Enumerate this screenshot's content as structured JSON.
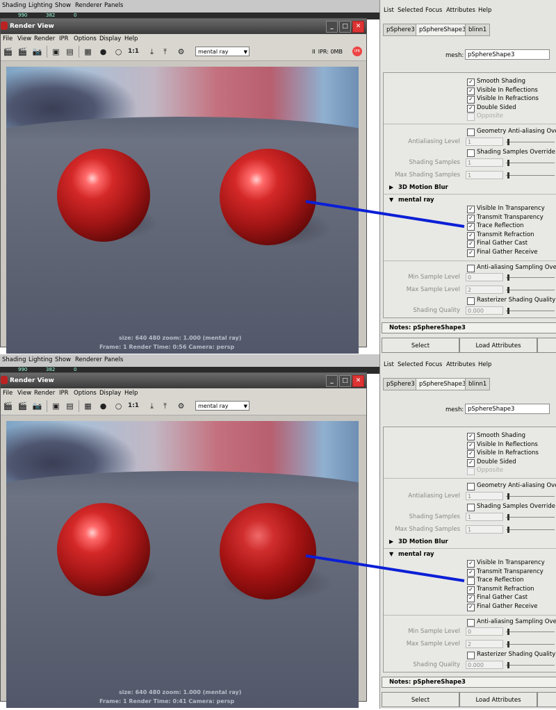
{
  "panels": [
    {
      "maya_menu": [
        "Shading",
        "Lighting",
        "Show",
        "Renderer",
        "Panels"
      ],
      "maya_strip": [
        "990",
        "382",
        "0"
      ],
      "render_view": {
        "title": "Render View",
        "menu": [
          "File",
          "View",
          "Render",
          "IPR",
          "Options",
          "Display",
          "Help"
        ],
        "ratio_label": "1:1",
        "renderer": "mental ray",
        "ipr_status": "IPR: 0MB",
        "ipr_badge": "IPR",
        "status_line1": "size:  640  480 zoom: 1.000       (mental ray)",
        "status_line2": "Frame: 1      Render Time: 0:56      Camera: persp"
      },
      "attribute_editor": {
        "menu": [
          "List",
          "Selected",
          "Focus",
          "Attributes",
          "Help"
        ],
        "tabs": [
          "pSphere3",
          "pSphereShape3",
          "blinn1"
        ],
        "mesh_label": "mesh:",
        "mesh_value": "pSphereShape3",
        "render_stats": [
          {
            "label": "Smooth Shading",
            "checked": true,
            "dim": false
          },
          {
            "label": "Visible In Reflections",
            "checked": true,
            "dim": false
          },
          {
            "label": "Visible In Refractions",
            "checked": true,
            "dim": false
          },
          {
            "label": "Double Sided",
            "checked": true,
            "dim": false
          },
          {
            "label": "Opposite",
            "checked": false,
            "dim": true
          }
        ],
        "geometry_aa_override": "Geometry Anti-aliasing Override",
        "aa_level_label": "Antialiasing Level",
        "aa_level_value": "1",
        "shading_samples_override": "Shading Samples Override",
        "shading_samples_label": "Shading Samples",
        "shading_samples_value": "1",
        "max_shading_samples_label": "Max Shading Samples",
        "max_shading_samples_value": "1",
        "section_motion_blur": "3D Motion Blur",
        "section_mental_ray": "mental ray",
        "mental_ray": [
          {
            "label": "Visible In Transparency",
            "checked": true
          },
          {
            "label": "Transmit Transparency",
            "checked": true
          },
          {
            "label": "Trace Reflection",
            "checked": true
          },
          {
            "label": "Transmit Refraction",
            "checked": true
          },
          {
            "label": "Final Gather Cast",
            "checked": true
          },
          {
            "label": "Final Gather Receive",
            "checked": true
          }
        ],
        "aa_sampling_override": "Anti-aliasing Sampling Override",
        "min_sample_label": "Min Sample Level",
        "min_sample_value": "0",
        "max_sample_label": "Max Sample Level",
        "max_sample_value": "2",
        "rasterizer_override": "Rasterizer Shading Quality Override",
        "shading_quality_label": "Shading Quality",
        "shading_quality_value": "0.000",
        "notes": "Notes:  pSphereShape3",
        "select_button": "Select",
        "load_button": "Load Attributes"
      }
    },
    {
      "maya_menu": [
        "Shading",
        "Lighting",
        "Show",
        "Renderer",
        "Panels"
      ],
      "maya_strip": [
        "990",
        "382",
        "0"
      ],
      "render_view": {
        "title": "Render View",
        "menu": [
          "File",
          "View",
          "Render",
          "IPR",
          "Options",
          "Display",
          "Help"
        ],
        "ratio_label": "1:1",
        "renderer": "mental ray",
        "ipr_status": "",
        "ipr_badge": "",
        "status_line1": "size:  640  480 zoom: 1.000       (mental ray)",
        "status_line2": "Frame: 1      Render Time: 0:41      Camera: persp"
      },
      "attribute_editor": {
        "menu": [
          "List",
          "Selected",
          "Focus",
          "Attributes",
          "Help"
        ],
        "tabs": [
          "pSphere3",
          "pSphereShape3",
          "blinn1"
        ],
        "mesh_label": "mesh:",
        "mesh_value": "pSphereShape3",
        "render_stats": [
          {
            "label": "Smooth Shading",
            "checked": true,
            "dim": false
          },
          {
            "label": "Visible In Reflections",
            "checked": true,
            "dim": false
          },
          {
            "label": "Visible In Refractions",
            "checked": true,
            "dim": false
          },
          {
            "label": "Double Sided",
            "checked": true,
            "dim": false
          },
          {
            "label": "Opposite",
            "checked": false,
            "dim": true
          }
        ],
        "geometry_aa_override": "Geometry Anti-aliasing Override",
        "aa_level_label": "Antialiasing Level",
        "aa_level_value": "1",
        "shading_samples_override": "Shading Samples Override",
        "shading_samples_label": "Shading Samples",
        "shading_samples_value": "1",
        "max_shading_samples_label": "Max Shading Samples",
        "max_shading_samples_value": "1",
        "section_motion_blur": "3D Motion Blur",
        "section_mental_ray": "mental ray",
        "mental_ray": [
          {
            "label": "Visible In Transparency",
            "checked": true
          },
          {
            "label": "Transmit Transparency",
            "checked": true
          },
          {
            "label": "Trace Reflection",
            "checked": false
          },
          {
            "label": "Transmit Refraction",
            "checked": true
          },
          {
            "label": "Final Gather Cast",
            "checked": true
          },
          {
            "label": "Final Gather Receive",
            "checked": true
          }
        ],
        "aa_sampling_override": "Anti-aliasing Sampling Override",
        "min_sample_label": "Min Sample Level",
        "min_sample_value": "0",
        "max_sample_label": "Max Sample Level",
        "max_sample_value": "2",
        "rasterizer_override": "Rasterizer Shading Quality Override",
        "shading_quality_label": "Shading Quality",
        "shading_quality_value": "0.000",
        "notes": "Notes:  pSphereShape3",
        "select_button": "Select",
        "load_button": "Load Attributes"
      }
    }
  ],
  "colors": {
    "annotation_line": "#0a1fd6",
    "sphere_red": "#b01818"
  }
}
